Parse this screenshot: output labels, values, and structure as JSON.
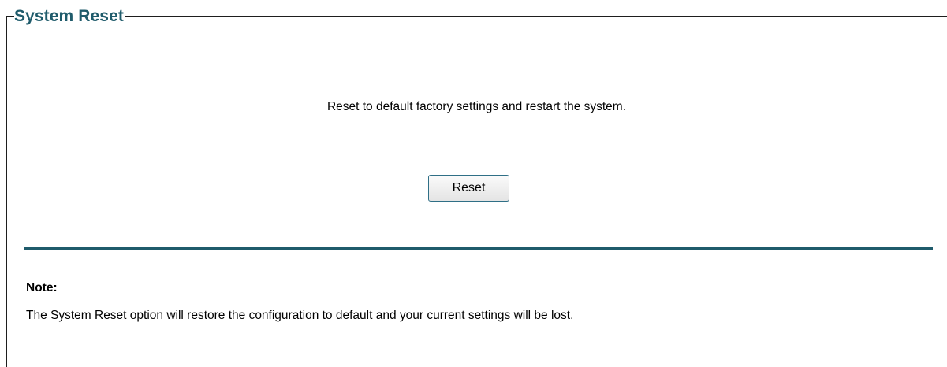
{
  "panel": {
    "title": "System Reset",
    "description": "Reset to default factory settings and restart the system.",
    "reset_button_label": "Reset",
    "accent_color": "#1f5b6b"
  },
  "note": {
    "title": "Note:",
    "text": "The System Reset option will restore the configuration to default and your current settings will be lost."
  }
}
